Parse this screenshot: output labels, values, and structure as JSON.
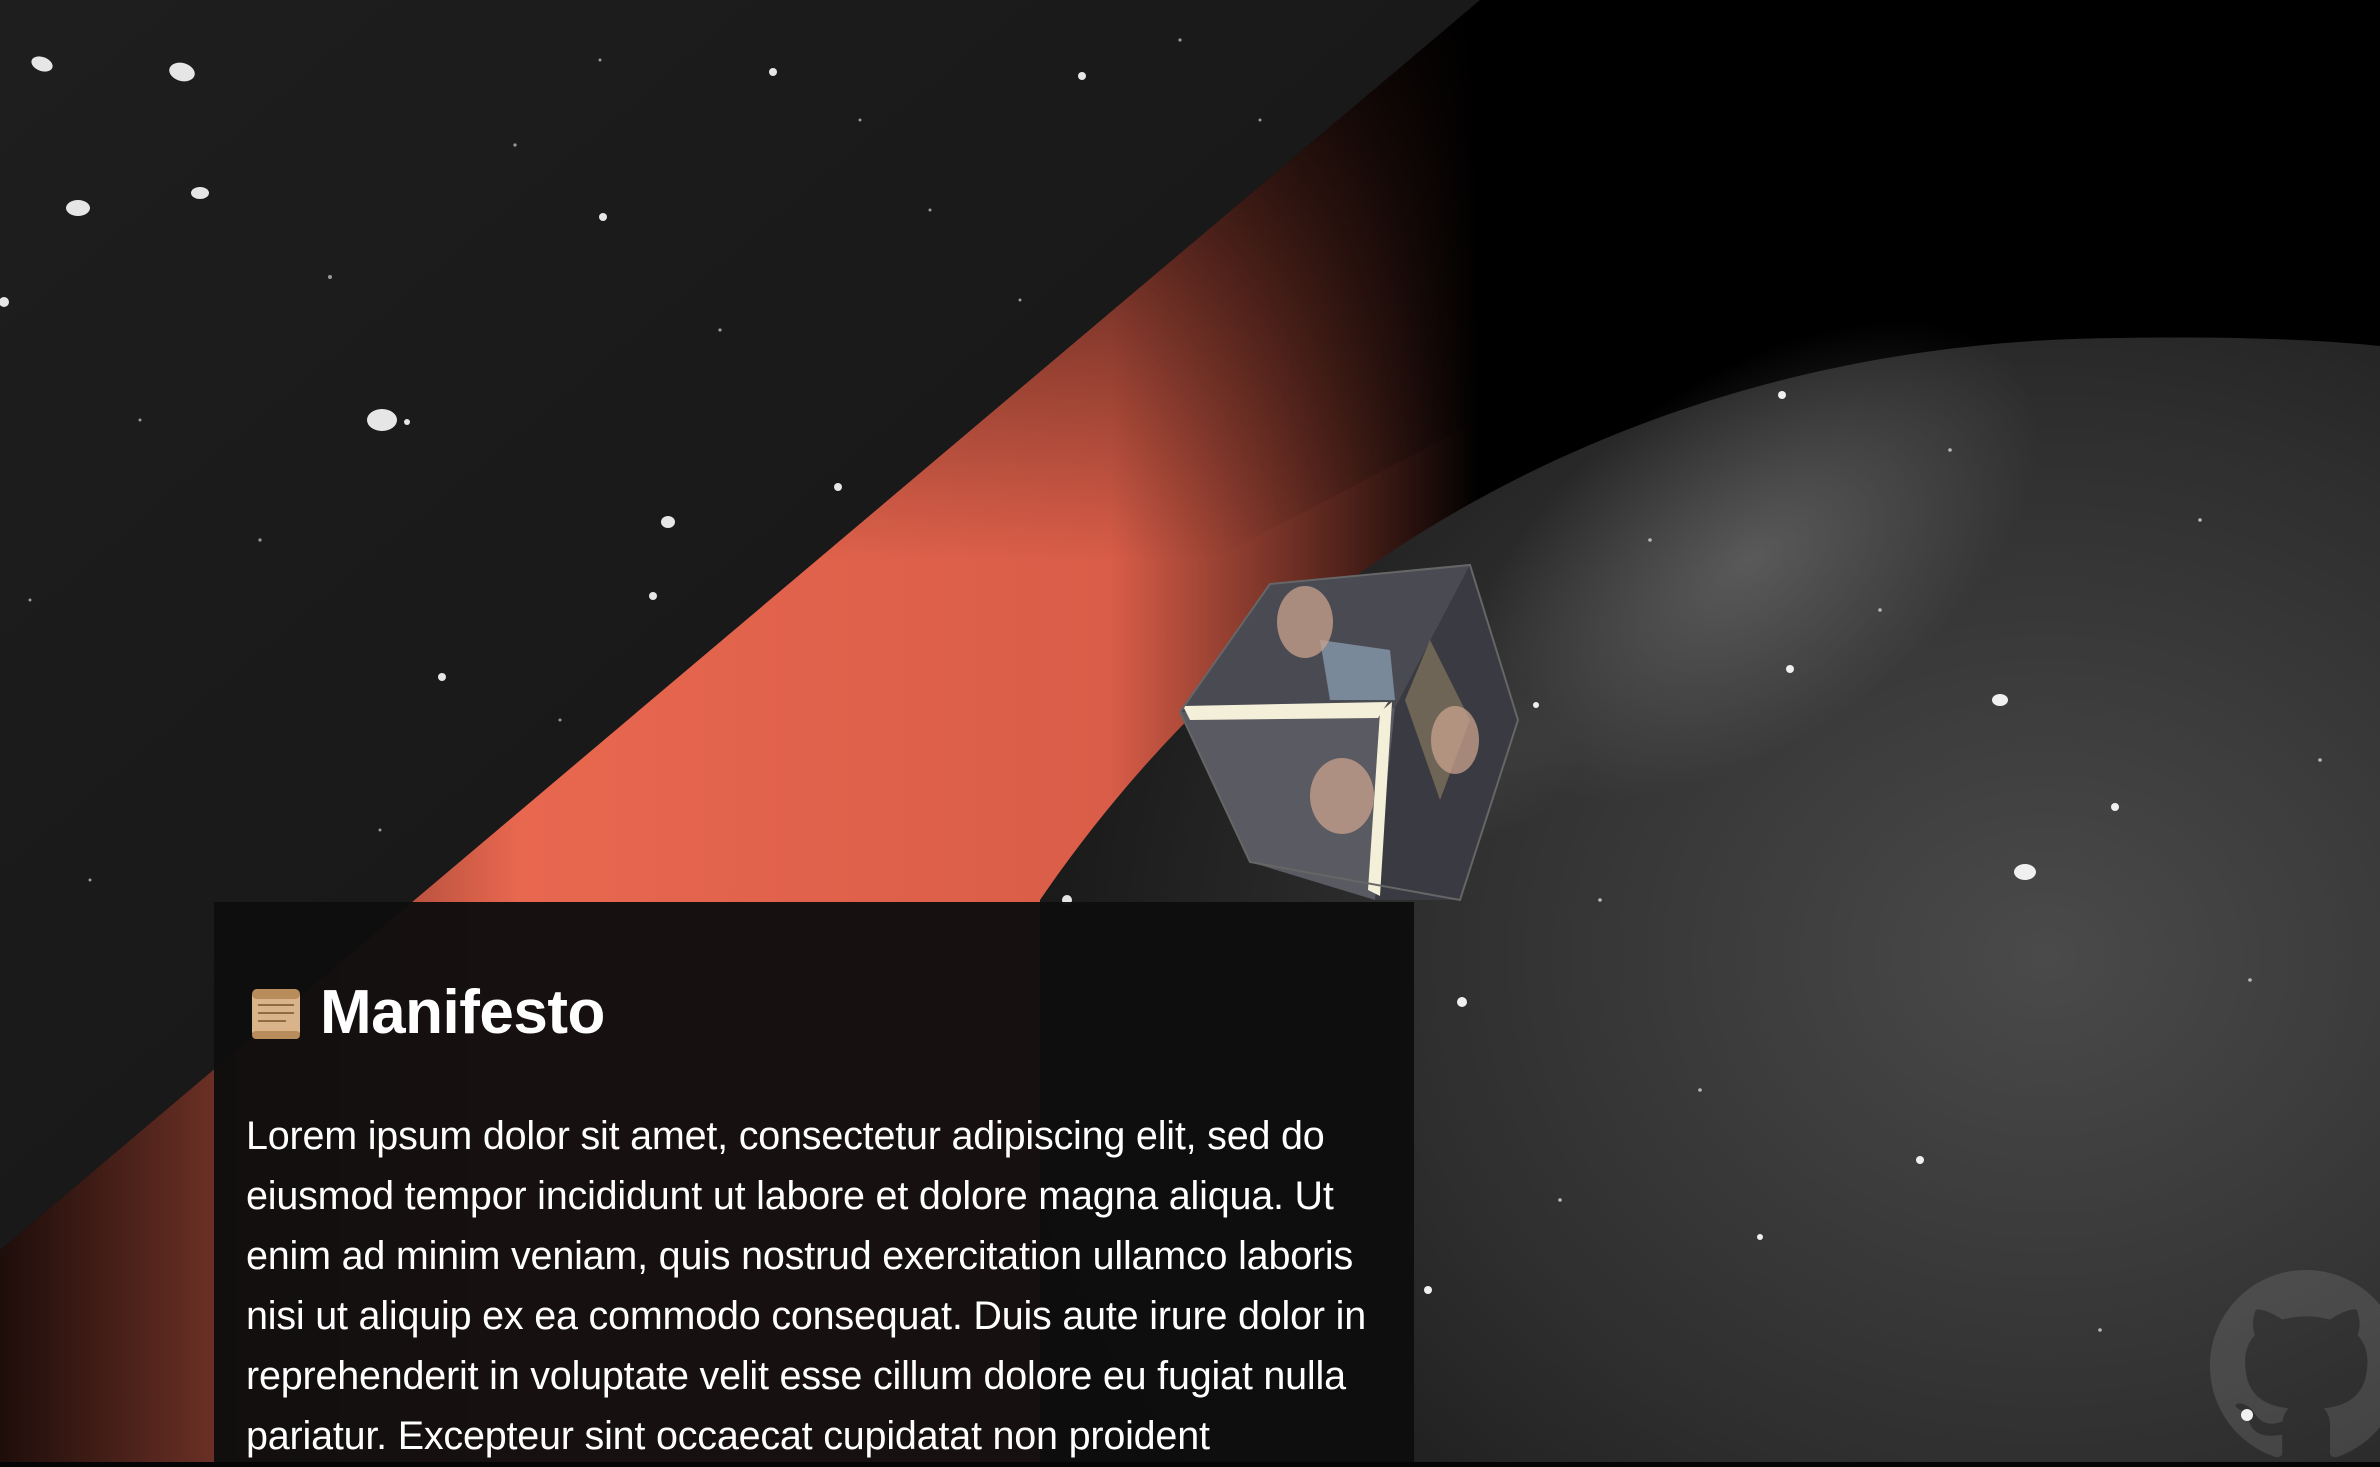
{
  "manifesto": {
    "icon": "scroll-icon",
    "title": "Manifesto",
    "body": "Lorem ipsum dolor sit amet, consectetur adipiscing elit, sed do eiusmod tempor incididunt ut labore et dolore magna aliqua. Ut enim ad minim veniam, quis nostrud exercitation ullamco laboris nisi ut aliquip ex ea commodo consequat. Duis aute irure dolor in reprehenderit in voluptate velit esse cillum dolore eu fugiat nulla pariatur. Excepteur sint occaecat cupidatat non proident"
  },
  "footer": {
    "github_icon": "github-icon"
  },
  "colors": {
    "accent": "#e8674f",
    "background": "#1b1b1b",
    "panel": "#0e0e0e",
    "text": "#ffffff"
  }
}
